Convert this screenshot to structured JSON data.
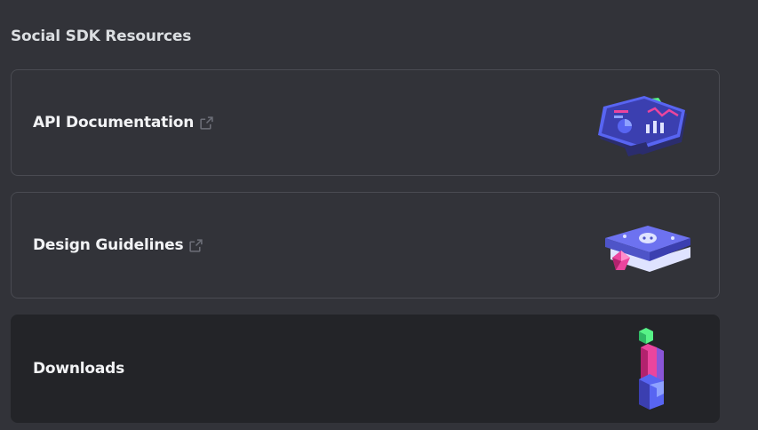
{
  "section": {
    "title": "Social SDK Resources"
  },
  "cards": [
    {
      "label": "API Documentation",
      "icon": "external-link-icon",
      "art": "api-dashboard-illustration"
    },
    {
      "label": "Design Guidelines",
      "icon": "external-link-icon",
      "art": "guidelines-book-illustration"
    },
    {
      "label": "Downloads",
      "art": "downloads-blocks-illustration"
    }
  ],
  "colors": {
    "background": "#323339",
    "card_border": "#4a4b52",
    "card_hover": "#232428",
    "text": "#f2f3f5",
    "muted_icon": "#6d6f78",
    "accent_purple": "#5865f2",
    "accent_pink": "#eb459e",
    "accent_green": "#57f287"
  }
}
